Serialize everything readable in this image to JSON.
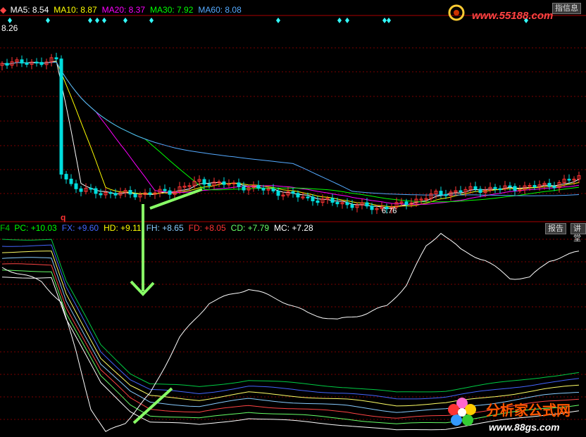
{
  "top_panel": {
    "first_value": "8.26",
    "low_label": "6.76",
    "marker_letter": "q",
    "legend": [
      {
        "label": "MA5:",
        "value": "8.54",
        "color": "#ffffff"
      },
      {
        "label": "MA10:",
        "value": "8.87",
        "color": "#ffff00"
      },
      {
        "label": "MA20:",
        "value": "8.37",
        "color": "#ff00ff"
      },
      {
        "label": "MA30:",
        "value": "7.92",
        "color": "#00ff00"
      },
      {
        "label": "MA60:",
        "value": "8.08",
        "color": "#55aaff"
      }
    ],
    "buttons": {
      "left": "指",
      "right": "信息"
    }
  },
  "bottom_panel": {
    "prefix": "F4",
    "legend": [
      {
        "label": "PC:",
        "value": "+10.03",
        "color": "#00ff00"
      },
      {
        "label": "FX:",
        "value": "+9.60",
        "color": "#4466ff"
      },
      {
        "label": "HD:",
        "value": "+9.11",
        "color": "#ffff00"
      },
      {
        "label": "FH:",
        "value": "+8.65",
        "color": "#88ccff"
      },
      {
        "label": "FD:",
        "value": "+8.05",
        "color": "#ff3333"
      },
      {
        "label": "CD:",
        "value": "+7.79",
        "color": "#66ff66"
      },
      {
        "label": "MC:",
        "value": "+7.28",
        "color": "#ffffff"
      }
    ],
    "buttons": {
      "report": "报告",
      "explain": "讲堂"
    }
  },
  "watermarks": {
    "top_url": "www.55188.com",
    "logo_name": "分析家公式网",
    "logo_url": "www.88gs.com"
  },
  "colors": {
    "background": "#000000",
    "grid": "#7a0000",
    "divider": "#aa0000",
    "up_candle": "#ff3333",
    "down_candle": "#00dddd",
    "annotation": "#88ff66"
  },
  "chart_data": [
    {
      "type": "candlestick",
      "title": "",
      "series": [
        {
          "name": "MA5",
          "values": [
            8.54
          ]
        },
        {
          "name": "MA10",
          "values": [
            8.87
          ]
        },
        {
          "name": "MA20",
          "values": [
            8.37
          ]
        },
        {
          "name": "MA30",
          "values": [
            7.92
          ]
        },
        {
          "name": "MA60",
          "values": [
            8.08
          ]
        }
      ],
      "price_labels": [
        "8.26",
        "6.76"
      ],
      "grid": true
    },
    {
      "type": "line",
      "title": "",
      "series": [
        {
          "name": "PC",
          "values": [
            10.03
          ]
        },
        {
          "name": "FX",
          "values": [
            9.6
          ]
        },
        {
          "name": "HD",
          "values": [
            9.11
          ]
        },
        {
          "name": "FH",
          "values": [
            8.65
          ]
        },
        {
          "name": "FD",
          "values": [
            8.05
          ]
        },
        {
          "name": "CD",
          "values": [
            7.79
          ]
        },
        {
          "name": "MC",
          "values": [
            7.28
          ]
        }
      ],
      "grid": true
    }
  ]
}
